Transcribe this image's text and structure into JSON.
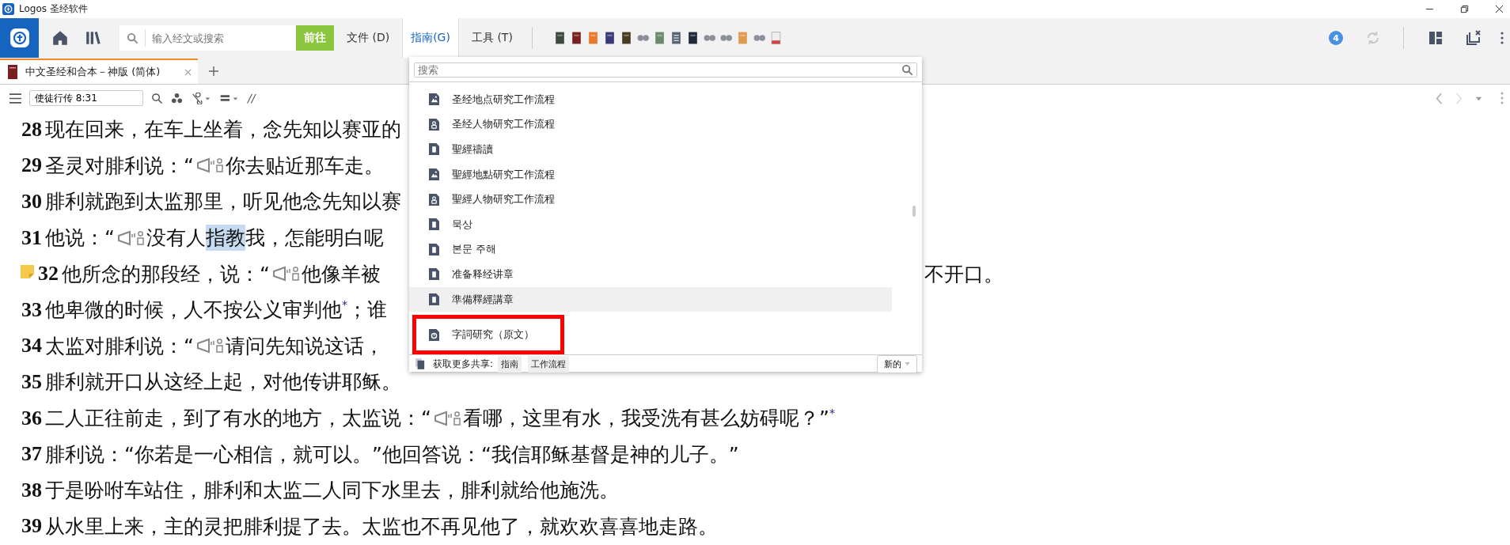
{
  "window": {
    "title": "Logos 圣经软件"
  },
  "toolbar": {
    "search": {
      "placeholder": "输入经文或搜索"
    },
    "go_button": "前往",
    "menus": [
      {
        "label": "文件 (D)",
        "selected": false
      },
      {
        "label": "指南(G)",
        "selected": true
      },
      {
        "label": "工具 (T)",
        "selected": false
      }
    ],
    "notification_count": "4"
  },
  "tabs": [
    {
      "label": "中文圣经和合本－神版 (简体)",
      "selected": true
    }
  ],
  "reference": {
    "value": "使徒行传 8:31"
  },
  "reader_toolbar": {
    "parallel_mark": "//"
  },
  "verses": [
    {
      "number": "28",
      "note": false,
      "segments": [
        {
          "kind": "text",
          "text": "现在回来，在车上坐着，念先知以赛亚的"
        }
      ]
    },
    {
      "number": "29",
      "note": false,
      "segments": [
        {
          "kind": "text",
          "text": "圣灵对腓利说：“"
        },
        {
          "kind": "audio"
        },
        {
          "kind": "text",
          "text": "你去贴近那车走。"
        }
      ]
    },
    {
      "number": "30",
      "note": false,
      "segments": [
        {
          "kind": "text",
          "text": "腓利就跑到太监那里，听见他念先知以赛"
        }
      ]
    },
    {
      "number": "31",
      "note": false,
      "segments": [
        {
          "kind": "text",
          "text": "他说：“"
        },
        {
          "kind": "audio"
        },
        {
          "kind": "text",
          "text": "没有人"
        },
        {
          "kind": "highlight",
          "text": "指教"
        },
        {
          "kind": "text",
          "text": "我，怎能明白呢"
        }
      ]
    },
    {
      "number": "32",
      "note": true,
      "segments": [
        {
          "kind": "text",
          "text": "他所念的那段经，说：“"
        },
        {
          "kind": "audio"
        },
        {
          "kind": "text",
          "text": "他像羊被"
        }
      ],
      "tail": "不开口。"
    },
    {
      "number": "33",
      "note": false,
      "segments": [
        {
          "kind": "text",
          "text": "他卑微的时候，人不按公义审判他"
        },
        {
          "kind": "footnote",
          "text": "*"
        },
        {
          "kind": "text",
          "text": "；谁"
        }
      ]
    },
    {
      "number": "34",
      "note": false,
      "segments": [
        {
          "kind": "text",
          "text": "太监对腓利说：“"
        },
        {
          "kind": "audio"
        },
        {
          "kind": "text",
          "text": "请问先知说这话，"
        }
      ]
    },
    {
      "number": "35",
      "note": false,
      "segments": [
        {
          "kind": "text",
          "text": "腓利就开口从这经上起，对他传讲耶稣。"
        }
      ]
    },
    {
      "number": "36",
      "note": false,
      "segments": [
        {
          "kind": "text",
          "text": "二人正往前走，到了有水的地方，太监说：“"
        },
        {
          "kind": "audio"
        },
        {
          "kind": "text",
          "text": "看哪，这里有水，我受洗有甚么妨碍呢？”"
        },
        {
          "kind": "footnote",
          "text": "*"
        }
      ]
    },
    {
      "number": "37",
      "note": false,
      "segments": [
        {
          "kind": "text",
          "text": "腓利说：“你若是一心相信，就可以。”他回答说：“我信耶稣基督是神的儿子。”"
        }
      ]
    },
    {
      "number": "38",
      "note": false,
      "segments": [
        {
          "kind": "text",
          "text": "于是吩咐车站住，腓利和太监二人同下水里去，腓利就给他施洗。"
        }
      ]
    },
    {
      "number": "39",
      "note": false,
      "segments": [
        {
          "kind": "text",
          "text": "从水里上来，主的灵把腓利提了去。太监也不再见他了，就欢欢喜喜地走路。"
        }
      ]
    }
  ],
  "guides_menu": {
    "search": {
      "placeholder": "搜索"
    },
    "items": [
      {
        "label": "圣经地点研究工作流程",
        "kind": "map",
        "selected": false,
        "outlined": false
      },
      {
        "label": "圣经人物研究工作流程",
        "kind": "person",
        "selected": false,
        "outlined": false
      },
      {
        "label": "聖經禱讀",
        "kind": "book",
        "selected": false,
        "outlined": false
      },
      {
        "label": "聖經地點研究工作流程",
        "kind": "map",
        "selected": false,
        "outlined": false
      },
      {
        "label": "聖經人物研究工作流程",
        "kind": "person",
        "selected": false,
        "outlined": false
      },
      {
        "label": "묵상",
        "kind": "book",
        "selected": false,
        "outlined": false
      },
      {
        "label": "본문 주해",
        "kind": "book",
        "selected": false,
        "outlined": false
      },
      {
        "label": "准备释经讲章",
        "kind": "book",
        "selected": false,
        "outlined": false
      },
      {
        "label": "準備釋經講章",
        "kind": "book",
        "selected": true,
        "outlined": false
      },
      {
        "label": "字詞研究（原文）",
        "kind": "word",
        "selected": false,
        "outlined": true
      }
    ],
    "footer": {
      "label": "获取更多共享:",
      "tags": [
        "指南",
        "工作流程"
      ],
      "sort_button": "新的"
    }
  }
}
